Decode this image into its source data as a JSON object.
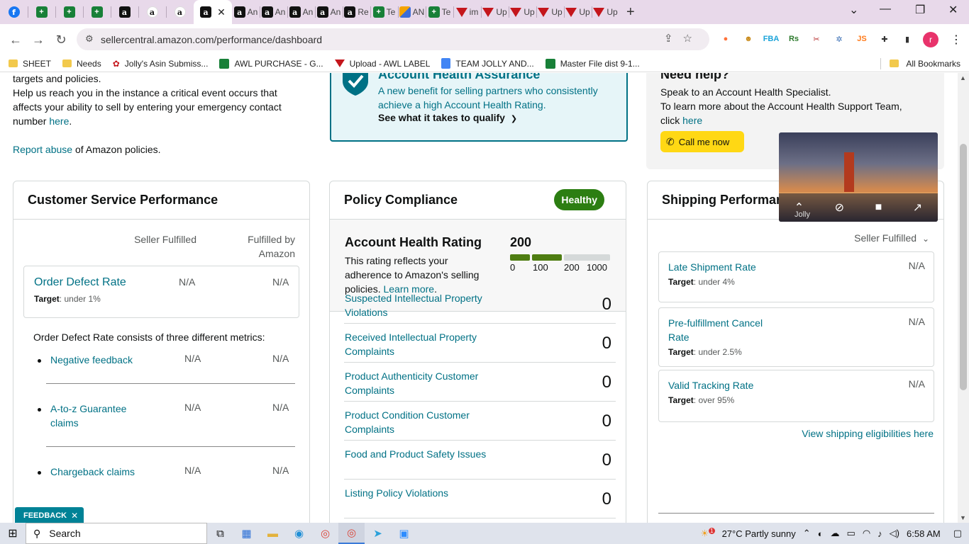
{
  "browser": {
    "tabs": [
      {
        "icon": "f",
        "kind": "fb",
        "title": ""
      },
      {
        "icon": "+",
        "kind": "sheet",
        "title": ""
      },
      {
        "icon": "+",
        "kind": "sheet",
        "title": ""
      },
      {
        "icon": "+",
        "kind": "sheet",
        "title": ""
      },
      {
        "icon": "a",
        "kind": "amz",
        "title": ""
      },
      {
        "icon": "a",
        "kind": "amzo",
        "title": ""
      },
      {
        "icon": "a",
        "kind": "amzo",
        "title": ""
      },
      {
        "icon": "a",
        "kind": "amz",
        "title": "",
        "active": true
      },
      {
        "icon": "a",
        "kind": "amz",
        "title": "An"
      },
      {
        "icon": "a",
        "kind": "amz",
        "title": "An"
      },
      {
        "icon": "a",
        "kind": "amz",
        "title": "An"
      },
      {
        "icon": "a",
        "kind": "amz",
        "title": "An"
      },
      {
        "icon": "a",
        "kind": "amz",
        "title": "Re"
      },
      {
        "icon": "+",
        "kind": "sheet",
        "title": "Te"
      },
      {
        "icon": "",
        "kind": "multi",
        "title": "AN"
      },
      {
        "icon": "+",
        "kind": "sheet",
        "title": "Te"
      },
      {
        "icon": "",
        "kind": "tri",
        "title": "im"
      },
      {
        "icon": "",
        "kind": "tri",
        "title": "Up"
      },
      {
        "icon": "",
        "kind": "tri",
        "title": "Up"
      },
      {
        "icon": "",
        "kind": "tri",
        "title": "Up"
      },
      {
        "icon": "",
        "kind": "tri",
        "title": "Up"
      },
      {
        "icon": "",
        "kind": "tri",
        "title": "Up"
      }
    ],
    "new_tab": "+",
    "tab_close": "✕",
    "window": {
      "menu": "⌄",
      "minimize": "—",
      "restore": "❐",
      "close": "✕"
    },
    "url": "sellercentral.amazon.com/performance/dashboard",
    "bookmarks": [
      {
        "label": "SHEET",
        "kind": "folder"
      },
      {
        "label": "Needs",
        "kind": "folder"
      },
      {
        "label": "Jolly's Asin Submiss...",
        "kind": "glyph"
      },
      {
        "label": "AWL PURCHASE - G...",
        "kind": "sheet"
      },
      {
        "label": "Upload - AWL LABEL",
        "kind": "tri"
      },
      {
        "label": "TEAM JOLLY AND...",
        "kind": "doc"
      },
      {
        "label": "Master File dist 9-1...",
        "kind": "sheet"
      }
    ],
    "all_bookmarks": "All Bookmarks",
    "profile_initial": "r",
    "extensions": [
      {
        "label": "●",
        "color": "#ff7139"
      },
      {
        "label": "☻",
        "color": "#c98a1a"
      },
      {
        "label": "FBA",
        "color": "#1aa3d9"
      },
      {
        "label": "Rs",
        "color": "#2d7a2d"
      },
      {
        "label": "✂",
        "color": "#b83232"
      },
      {
        "label": "✲",
        "color": "#3a6fb5"
      },
      {
        "label": "JS",
        "color": "#ff7a1a"
      },
      {
        "label": "✚",
        "color": "#333333"
      },
      {
        "label": "▮",
        "color": "#333333"
      }
    ]
  },
  "page": {
    "top_left": {
      "line1": "targets and policies.",
      "line2": "Help us reach you in the instance a critical event occurs that",
      "line3": "affects your ability to sell by entering your emergency contact",
      "line4_pre": "number ",
      "line4_link": "here",
      "line4_post": ".",
      "report_link": "Report abuse",
      "report_post": " of Amazon policies."
    },
    "aha": {
      "title": "Account Health Assurance",
      "body1": "A new benefit for selling partners who consistently",
      "body2": "achieve a high Account Health Rating.",
      "link": "See what it takes to qualify",
      "chevron": "❯"
    },
    "help": {
      "title": "Need help?",
      "body1": "Speak to an Account Health Specialist.",
      "body2": "To learn more about the Account Health Support Team,",
      "body3_pre": "click ",
      "body3_link": "here",
      "call_button": "Call me now",
      "phone_icon": "✆"
    },
    "customer_service": {
      "title": "Customer Service Performance",
      "col1": "Seller Fulfilled",
      "col2a": "Fulfilled by",
      "col2b": "Amazon",
      "odr_name": "Order Defect Rate",
      "odr_v1": "N/A",
      "odr_v2": "N/A",
      "odr_target_label": "Target",
      "odr_target": ": under 1%",
      "consists": "Order Defect Rate consists of three different metrics:",
      "metrics": [
        {
          "line1": "Negative feedback",
          "line2": "",
          "v1": "N/A",
          "v2": "N/A"
        },
        {
          "line1": "A-to-z Guarantee",
          "line2": "claims",
          "v1": "N/A",
          "v2": "N/A"
        },
        {
          "line1": "Chargeback claims",
          "line2": "",
          "v1": "N/A",
          "v2": "N/A"
        }
      ]
    },
    "policy": {
      "title": "Policy Compliance",
      "badge": "Healthy",
      "ahr_title": "Account Health Rating",
      "ahr_desc_pre": "This rating reflects your adherence to Amazon's selling policies. ",
      "ahr_learn": "Learn more",
      "ahr_desc_post": ".",
      "ahr_score": "200",
      "ahr_scale": [
        "0",
        "100",
        "200",
        "1000"
      ],
      "ahr_colors": {
        "low": "#4e7d12",
        "mid": "#4e7d12",
        "rest": "#d5d9d9"
      },
      "rows": [
        {
          "line1": "Suspected Intellectual Property",
          "line2": "Violations",
          "count": "0"
        },
        {
          "line1": "Received Intellectual Property",
          "line2": "Complaints",
          "count": "0"
        },
        {
          "line1": "Product Authenticity Customer",
          "line2": "Complaints",
          "count": "0"
        },
        {
          "line1": "Product Condition Customer",
          "line2": "Complaints",
          "count": "0"
        },
        {
          "line1": "Food and Product Safety Issues",
          "line2": "",
          "count": "0"
        },
        {
          "line1": "Listing Policy Violations",
          "line2": "",
          "count": "0"
        }
      ]
    },
    "shipping": {
      "title": "Shipping Performance",
      "filter": "Seller Fulfilled",
      "filter_icon": "⌄",
      "metrics": [
        {
          "line1": "Late Shipment Rate",
          "line2": "",
          "value": "N/A",
          "target_label": "Target",
          "target": ": under 4%"
        },
        {
          "line1": "Pre-fulfillment Cancel",
          "line2": "Rate",
          "value": "N/A",
          "target_label": "Target",
          "target": ": under 2.5%"
        },
        {
          "line1": "Valid Tracking Rate",
          "line2": "",
          "value": "N/A",
          "target_label": "Target",
          "target": ": over 95%"
        }
      ],
      "link": "View shipping eligibilities here"
    },
    "feedback": "FEEDBACK",
    "feedback_close": "✕",
    "video_name": "Jolly"
  },
  "taskbar": {
    "search": "Search",
    "weather_badge": "1",
    "weather": "27°C  Partly sunny",
    "time": "6:58 AM"
  }
}
